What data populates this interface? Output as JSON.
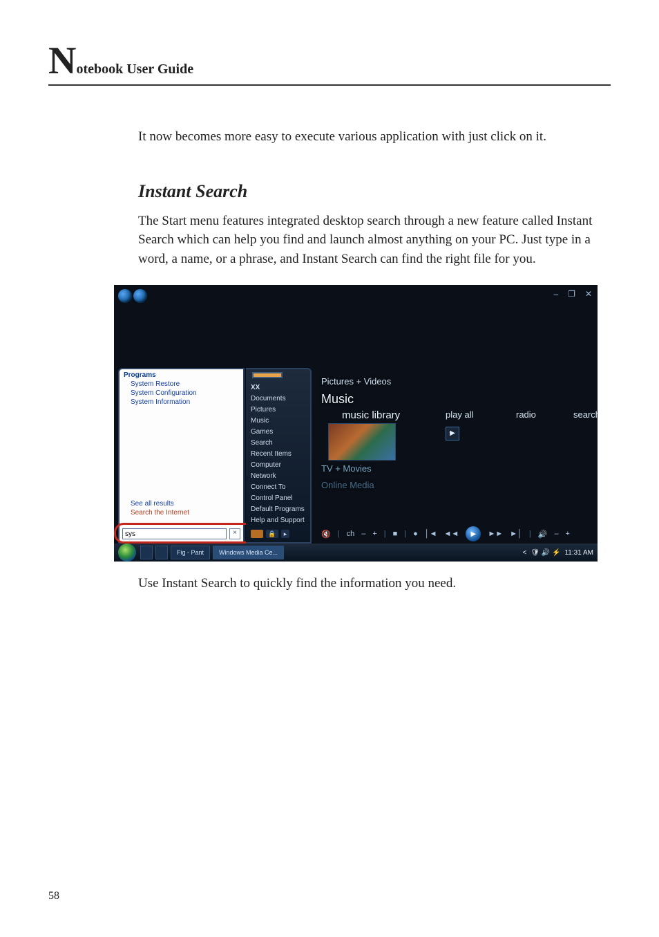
{
  "header": {
    "big_letter": "N",
    "rest": "otebook User Guide"
  },
  "intro_line": "It now becomes more easy to execute various application with just click on it.",
  "section_title": "Instant Search",
  "section_body": "The Start menu features integrated desktop search through a new feature called Instant Search which can help you find and launch almost anything on your PC. Just type in a word, a name, or a phrase, and Instant Search can find the right file for you.",
  "caption": "Use Instant Search to quickly find the information you need.",
  "page_number": "58",
  "screenshot": {
    "window_controls": {
      "min": "–",
      "max": "❐",
      "close": "✕"
    },
    "start_menu": {
      "left": {
        "header": "Programs",
        "items": [
          "System Restore",
          "System Configuration",
          "System Information"
        ],
        "see_all": "See all results",
        "search_internet": "Search the Internet",
        "search_value": "sys",
        "close_x": "×"
      },
      "right": {
        "username": "XX",
        "items": [
          "Documents",
          "Pictures",
          "Music",
          "Games",
          "Search",
          "Recent Items",
          "Computer",
          "Network",
          "Connect To",
          "Control Panel",
          "Default Programs",
          "Help and Support"
        ],
        "power_icon": "⏻",
        "lock_icon": "🔒",
        "arrow_icon": "▸"
      }
    },
    "media_center": {
      "row1": "Pictures + Videos",
      "row2": "Music",
      "row2_items": {
        "library": "music library",
        "play_all": "play all",
        "radio": "radio",
        "search": "search",
        "play_icon": "▶"
      },
      "row3": "TV + Movies",
      "row4": "Online Media",
      "playback": {
        "mute": "🔇",
        "ch": "ch",
        "minus": "–",
        "plus": "+",
        "stop": "■",
        "rec": "●",
        "prev": "│◄",
        "rew": "◄◄",
        "play": "▶",
        "fwd": "►►",
        "next": "►│",
        "vol": "🔊",
        "vminus": "–",
        "vplus": "+"
      }
    },
    "taskbar": {
      "tasks": [
        "",
        "",
        "Fig - Pant"
      ],
      "active_task": "Windows Media Ce...",
      "tray": {
        "lang": "<",
        "icons": "🛡 🔊 ⚡",
        "time": "11:31 AM"
      }
    }
  }
}
